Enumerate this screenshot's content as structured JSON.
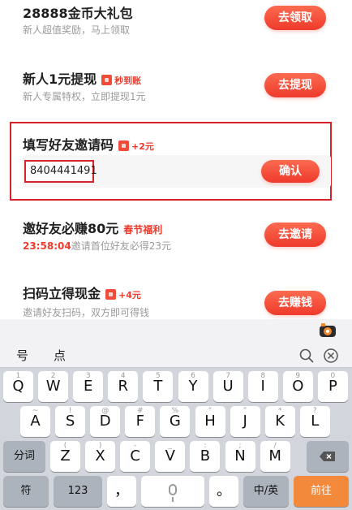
{
  "tasks": [
    {
      "title": "28888金币大礼包",
      "sub": "新人超值奖励，马上领取",
      "button": "去领取"
    },
    {
      "title": "新人1元提现",
      "badge": "秒到账",
      "sub": "新人专属特权，立即提现1元",
      "button": "去提现"
    },
    {
      "title": "填写好友邀请码",
      "badge": "+2元",
      "code_value": "8404441491",
      "button": "确认"
    },
    {
      "title": "邀好友必赚80元",
      "tag": "春节福利",
      "countdown": "23:58:04",
      "sub": "邀请首位好友必得23元",
      "button": "去邀请"
    },
    {
      "title": "扫码立得现金",
      "badge": "+4元",
      "sub": "邀请好友扫码，双方即可得钱",
      "button": "去赚钱"
    }
  ],
  "keyboard": {
    "candidates": [
      "号",
      "点"
    ],
    "row1": [
      {
        "k": "Q",
        "s": "1"
      },
      {
        "k": "W",
        "s": "2"
      },
      {
        "k": "E",
        "s": "3"
      },
      {
        "k": "R",
        "s": "4"
      },
      {
        "k": "T",
        "s": "5"
      },
      {
        "k": "Y",
        "s": "6"
      },
      {
        "k": "U",
        "s": "7"
      },
      {
        "k": "I",
        "s": "8"
      },
      {
        "k": "O",
        "s": "9"
      },
      {
        "k": "P",
        "s": "0"
      }
    ],
    "row2": [
      {
        "k": "A",
        "s": "~"
      },
      {
        "k": "S",
        "s": "!"
      },
      {
        "k": "D",
        "s": "@"
      },
      {
        "k": "F",
        "s": "#"
      },
      {
        "k": "G",
        "s": "%"
      },
      {
        "k": "H",
        "s": "“"
      },
      {
        "k": "J",
        "s": "”"
      },
      {
        "k": "K",
        "s": "*"
      },
      {
        "k": "L",
        "s": "?"
      }
    ],
    "row3": [
      {
        "k": "Z",
        "s": "("
      },
      {
        "k": "X",
        "s": ")"
      },
      {
        "k": "C",
        "s": "-"
      },
      {
        "k": "V",
        "s": "_"
      },
      {
        "k": "B",
        "s": ":"
      },
      {
        "k": "N",
        "s": ";"
      },
      {
        "k": "M",
        "s": "/"
      }
    ],
    "shift_label": "分词",
    "symbol_label": "符",
    "num_label": "123",
    "comma": "，",
    "period": "。",
    "lang_label": "中/英",
    "go_label": "前往"
  }
}
